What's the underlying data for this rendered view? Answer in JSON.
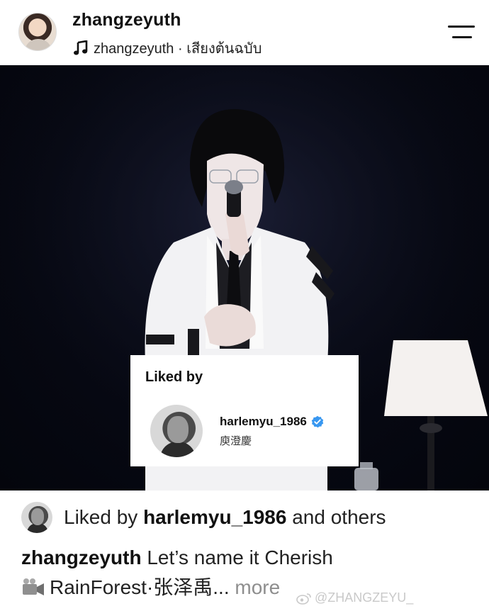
{
  "header": {
    "username": "zhangzeyuth",
    "audio_label": "zhangzeyuth · เสียงต้นฉบับ"
  },
  "popup": {
    "title": "Liked by",
    "liker_username": "harlemyu_1986",
    "liker_name": "庾澄慶"
  },
  "footer": {
    "likes_prefix": "Liked by ",
    "likes_user": "harlemyu_1986",
    "likes_suffix": " and others",
    "caption_user": "zhangzeyuth",
    "caption_line1": " Let’s name it Cherish",
    "caption_line2": "RainForest·张泽禹...",
    "more_label": " more",
    "watermark": "@ZHANGZEYU_"
  },
  "colors": {
    "verified_blue": "#3897f0",
    "muted_text": "#8e8e8e",
    "media_background": "#060812"
  },
  "icons": [
    "music-note-icon",
    "menu-icon",
    "verified-badge-icon",
    "video-camera-icon",
    "weibo-icon"
  ]
}
